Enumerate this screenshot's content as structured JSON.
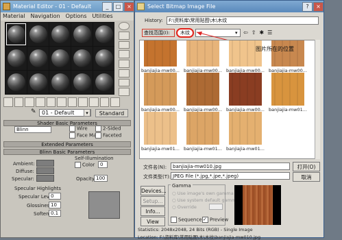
{
  "material_editor": {
    "title": "Material Editor - 01 - Default",
    "menu": [
      "Material",
      "Navigation",
      "Options",
      "Utilities"
    ],
    "material_name": "01 - Default",
    "type_button": "Standard",
    "rollouts": {
      "shader_basic": "Shader Basic Parameters",
      "extended": "Extended Parameters",
      "blinn_basic": "Blinn Basic Parameters",
      "specular_highlights": "Specular Highlights"
    },
    "shader": "Blinn",
    "options": {
      "wire": "Wire",
      "two_sided": "2-Sided",
      "face_map": "Face Map",
      "faceted": "Faceted"
    },
    "self_illumination": {
      "label": "Self-Illumination",
      "color": "Color",
      "value": "0"
    },
    "ambient": "Ambient:",
    "diffuse": "Diffuse:",
    "specular": "Specular:",
    "opacity_label": "Opacity:",
    "opacity_value": "100",
    "specular_level_label": "Specular Level:",
    "specular_level_value": "0",
    "glossiness_label": "Glossiness:",
    "glossiness_value": "10",
    "soften_label": "Soften:",
    "soften_value": "0.1"
  },
  "dialog": {
    "title": "Select Bitmap Image File",
    "history_label": "History:",
    "history_value": "F:\\资料库\\常用贴图\\木\\木纹",
    "find_in_label": "查找范围(I):",
    "find_in_value": "木纹",
    "annotation": "图片所在的位置",
    "thumbnails": [
      {
        "caption": "banjiajia-mw00...",
        "color": "#c4732e"
      },
      {
        "caption": "banjiajia-mw00...",
        "color": "#e7b47a"
      },
      {
        "caption": "banjiajia-mw00...",
        "color": "#f0c48c"
      },
      {
        "caption": "banjiajia-mw00...",
        "color": "#c8884f"
      },
      {
        "caption": "banjiajia-mw00...",
        "color": "#d49a5a"
      },
      {
        "caption": "banjiajia-mw00...",
        "color": "#ad6a34"
      },
      {
        "caption": "banjiajia-mw00...",
        "color": "#8a3d22"
      },
      {
        "caption": "banjiajia-mw01...",
        "color": "#d8943e"
      },
      {
        "caption": "banjiajia-mw01...",
        "color": "#ecc08a"
      },
      {
        "caption": "banjiajia-mw01...",
        "color": "#dca566"
      },
      {
        "caption": "banjiajia-mw01...",
        "color": "#e4b070"
      }
    ],
    "filename_label": "文件名(N):",
    "filename_value": "banjiajia-mw010.jpg",
    "filetype_label": "文件类型(T):",
    "filetype_value": "JPEG File (*.jpg,*.jpe,*.jpeg)",
    "open_button": "打开(O)",
    "cancel_button": "取消",
    "side_buttons": [
      "Devices...",
      "Setup...",
      "Info...",
      "View"
    ],
    "gamma": {
      "title": "Gamma",
      "opt1": "Use image's own gamma",
      "opt2": "Use system default gamma",
      "opt3": "Override"
    },
    "sequence": "Sequence",
    "preview": "Preview",
    "statistics": "Statistics:  2048x2048, 24 Bits (RGB) - Single Image",
    "location": "Location:  F:\\资料库\\常用贴图\\木\\木纹\\banjiajia-mw010.jpg"
  }
}
